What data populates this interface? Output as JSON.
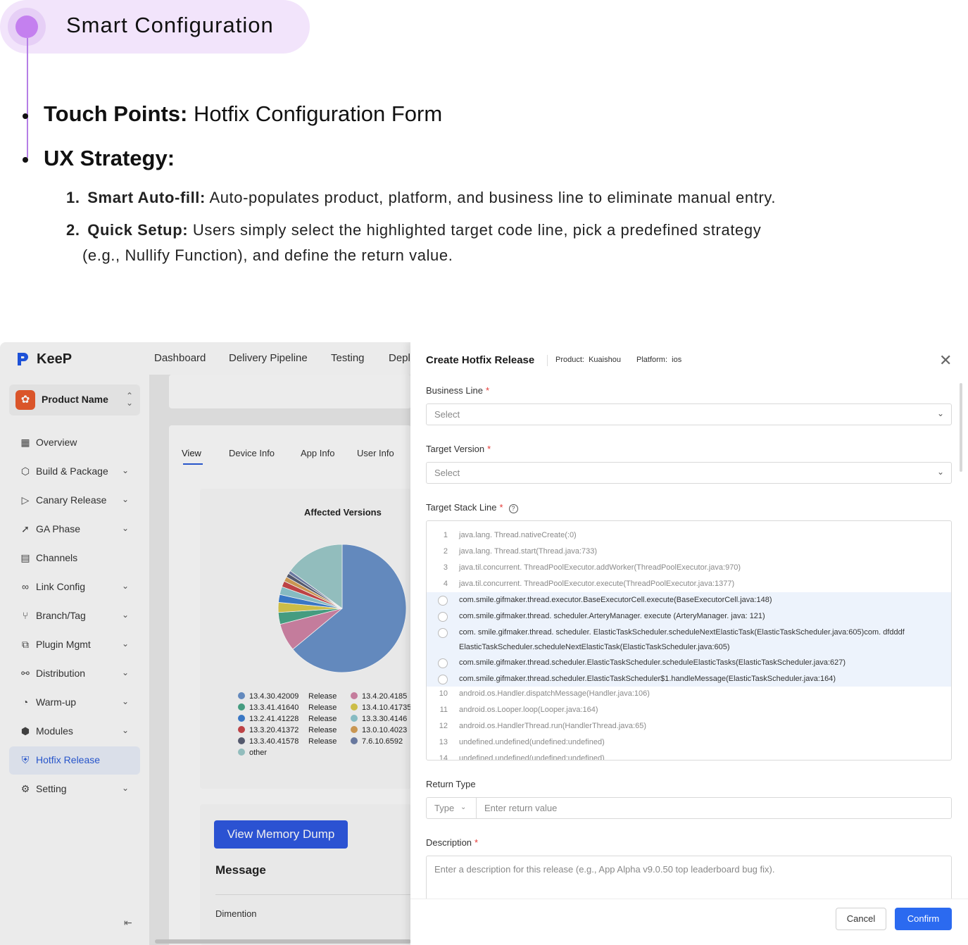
{
  "annotation": {
    "title": "Smart Configuration",
    "touch_points_label": "Touch Points:",
    "touch_points_value": "Hotfix Configuration Form",
    "ux_strategy_label": "UX Strategy:",
    "items": [
      {
        "num": "1.",
        "label": "Smart Auto-fill:",
        "text": "Auto-populates product, platform, and business line to eliminate manual entry."
      },
      {
        "num": "2.",
        "label": "Quick Setup:",
        "text": "Users simply select the highlighted target code line, pick a predefined strategy",
        "text2": "(e.g., Nullify Function), and define the return value."
      }
    ]
  },
  "app": {
    "logo": "KeeP",
    "product_name": "Product Name",
    "top_nav": [
      "Dashboard",
      "Delivery Pipeline",
      "Testing",
      "Depl"
    ],
    "sidebar": [
      {
        "label": "Overview",
        "icon": "grid-icon",
        "chev": false
      },
      {
        "label": "Build & Package",
        "icon": "package-icon",
        "chev": true
      },
      {
        "label": "Canary Release",
        "icon": "send-icon",
        "chev": true
      },
      {
        "label": "GA Phase",
        "icon": "paper-plane-icon",
        "chev": true
      },
      {
        "label": "Channels",
        "icon": "channels-icon",
        "chev": false
      },
      {
        "label": "Link Config",
        "icon": "link-icon",
        "chev": true
      },
      {
        "label": "Branch/Tag",
        "icon": "branch-icon",
        "chev": true
      },
      {
        "label": "Plugin Mgmt",
        "icon": "plugin-icon",
        "chev": true
      },
      {
        "label": "Distribution",
        "icon": "distribution-icon",
        "chev": true
      },
      {
        "label": "Warm-up",
        "icon": "warmup-icon",
        "chev": true
      },
      {
        "label": "Modules",
        "icon": "modules-icon",
        "chev": true
      },
      {
        "label": "Hotfix Release",
        "icon": "shield-icon",
        "chev": false,
        "active": true
      },
      {
        "label": "Setting",
        "icon": "gear-icon",
        "chev": true
      }
    ],
    "tabs": [
      "View",
      "Device Info",
      "App Info",
      "User Info"
    ],
    "view_memory_dump": "View Memory Dump",
    "message": "Message",
    "dimention": "Dimention"
  },
  "chart_data": {
    "type": "pie",
    "title": "Affected Versions",
    "slices": [
      {
        "name": "13.4.30.42009",
        "tag": "Release",
        "value": 64,
        "color": "#6a92c9"
      },
      {
        "name": "13.4.20.4185",
        "tag": "",
        "value": 7,
        "color": "#d184a6"
      },
      {
        "name": "13.3.41.41640",
        "tag": "Release",
        "value": 3,
        "color": "#4aa688"
      },
      {
        "name": "13.4.10.41735",
        "tag": "",
        "value": 2.5,
        "color": "#d9c94c"
      },
      {
        "name": "13.2.41.41228",
        "tag": "Release",
        "value": 2,
        "color": "#3d7fd1"
      },
      {
        "name": "13.3.30.4146",
        "tag": "",
        "value": 2,
        "color": "#8fc7cf"
      },
      {
        "name": "13.3.20.41372",
        "tag": "Release",
        "value": 1.5,
        "color": "#c9474a"
      },
      {
        "name": "13.0.10.4023",
        "tag": "",
        "value": 1.2,
        "color": "#d6a058"
      },
      {
        "name": "13.3.40.41578",
        "tag": "Release",
        "value": 1,
        "color": "#5a5f74"
      },
      {
        "name": "7.6.10.6592",
        "tag": "",
        "value": 0.8,
        "color": "#6f80a8"
      },
      {
        "name": "other",
        "tag": "",
        "value": 15,
        "color": "#9cc9c9"
      }
    ]
  },
  "modal": {
    "title": "Create Hotfix Release",
    "product_label": "Product:",
    "product_value": "Kuaishou",
    "platform_label": "Platform:",
    "platform_value": "ios",
    "business_line_label": "Business Line",
    "business_line_placeholder": "Select",
    "target_version_label": "Target Version",
    "target_version_placeholder": "Select",
    "target_stack_label": "Target Stack Line",
    "required_mark": "*",
    "help_glyph": "?",
    "stack_lines": [
      {
        "n": "1",
        "t": "java.lang. Thread.nativeCreate(:0)"
      },
      {
        "n": "2",
        "t": "java.lang. Thread.start(Thread.java:733)"
      },
      {
        "n": "3",
        "t": "java.til.concurrent. ThreadPoolExecutor.addWorker(ThreadPoolExecutor.java:970)"
      },
      {
        "n": "4",
        "t": "java.til.concurrent. ThreadPoolExecutor.execute(ThreadPoolExecutor.java:1377)"
      }
    ],
    "highlight_lines": [
      "com.smile.gifmaker.thread.executor.BaseExecutorCell.execute(BaseExecutorCell.java:148)",
      "com.smile.gifmaker.thread. scheduler.ArteryManager. execute (ArteryManager. java: 121)",
      "com. smile.gifmaker.thread. scheduler. ElasticTaskScheduler.scheduleNextElasticTask(ElasticTaskScheduler.java:605)com. dfdddf",
      "ElasticTaskScheduler.scheduleNextElasticTask(ElasticTaskScheduler.java:605)",
      "com.smile.gifmaker.thread.scheduler.ElasticTaskScheduler.scheduleElasticTasks(ElasticTaskScheduler.java:627)",
      "com.smile.gifmaker.thread.scheduler.ElasticTaskScheduler$1.handleMessage(ElasticTaskScheduler.java:164)"
    ],
    "stack_lines_after": [
      {
        "n": "10",
        "t": "android.os.Handler.dispatchMessage(Handler.java:106)"
      },
      {
        "n": "11",
        "t": "android.os.Looper.loop(Looper.java:164)"
      },
      {
        "n": "12",
        "t": "android.os.HandlerThread.run(HandlerThread.java:65)"
      },
      {
        "n": "13",
        "t": "undefined.undefined(undefined:undefined)"
      },
      {
        "n": "14",
        "t": "undefined.undefined(undefined:undefined)"
      }
    ],
    "return_type_label": "Return Type",
    "type_placeholder": "Type",
    "return_value_placeholder": "Enter return value",
    "description_label": "Description",
    "description_placeholder": "Enter a description for this release (e.g., App Alpha v9.0.50 top leaderboard bug fix).",
    "cancel": "Cancel",
    "confirm": "Confirm"
  }
}
